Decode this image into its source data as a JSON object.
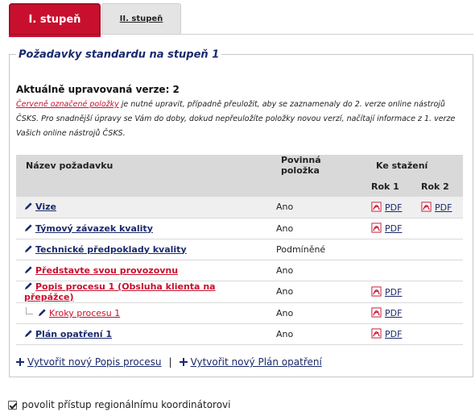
{
  "tabs": {
    "active_label": "I. stupeň",
    "inactive_label": "II. stupeň"
  },
  "section": {
    "legend": "Požadavky standardu na stupeň 1",
    "version": "Aktuálně upravovaná verze: 2",
    "note_red": "Červeně označené položky",
    "note_rest": " je nutné upravit, případně přeuložit, aby se zaznamenaly do 2. verze online nástrojů ČSKS. Pro snadnější úpravy se Vám do doby, dokud nepřeuložíte položky novou verzí, načítají informace z 1. verze Vašich online nástrojů ČSKS."
  },
  "table": {
    "col_name": "Název požadavku",
    "col_mandatory": "Povinná položka",
    "col_download": "Ke stažení",
    "col_year1": "Rok 1",
    "col_year2": "Rok 2",
    "rows": [
      {
        "name": "Vize",
        "mandatory": "Ano",
        "pdf1": "PDF",
        "pdf2": "PDF"
      },
      {
        "name": "Týmový závazek kvality",
        "mandatory": "Ano",
        "pdf1": "PDF",
        "pdf2": ""
      },
      {
        "name": "Technické předpoklady kvality",
        "mandatory": "Podmíněné",
        "pdf1": "",
        "pdf2": ""
      },
      {
        "name": "Představte svou provozovnu",
        "mandatory": "Ano",
        "pdf1": "",
        "pdf2": ""
      },
      {
        "name": "Popis procesu 1 (Obsluha klienta na přepážce)",
        "mandatory": "Ano",
        "pdf1": "PDF",
        "pdf2": ""
      },
      {
        "name": "Kroky procesu 1",
        "mandatory": "Ano",
        "pdf1": "PDF",
        "pdf2": ""
      },
      {
        "name": "Plán opatření 1",
        "mandatory": "Ano",
        "pdf1": "PDF",
        "pdf2": ""
      }
    ]
  },
  "actions": {
    "new_process": "Vytvořit nový Popis procesu",
    "separator": "|",
    "new_plan": "Vytvořit nový Plán opatření"
  },
  "consent": {
    "label": "povolit přístup regionálnímu koordinátorovi",
    "checked": true
  },
  "colors": {
    "accent_red": "#c8102e",
    "link_blue": "#1a2a6c",
    "header_gray": "#d9d9d9"
  }
}
